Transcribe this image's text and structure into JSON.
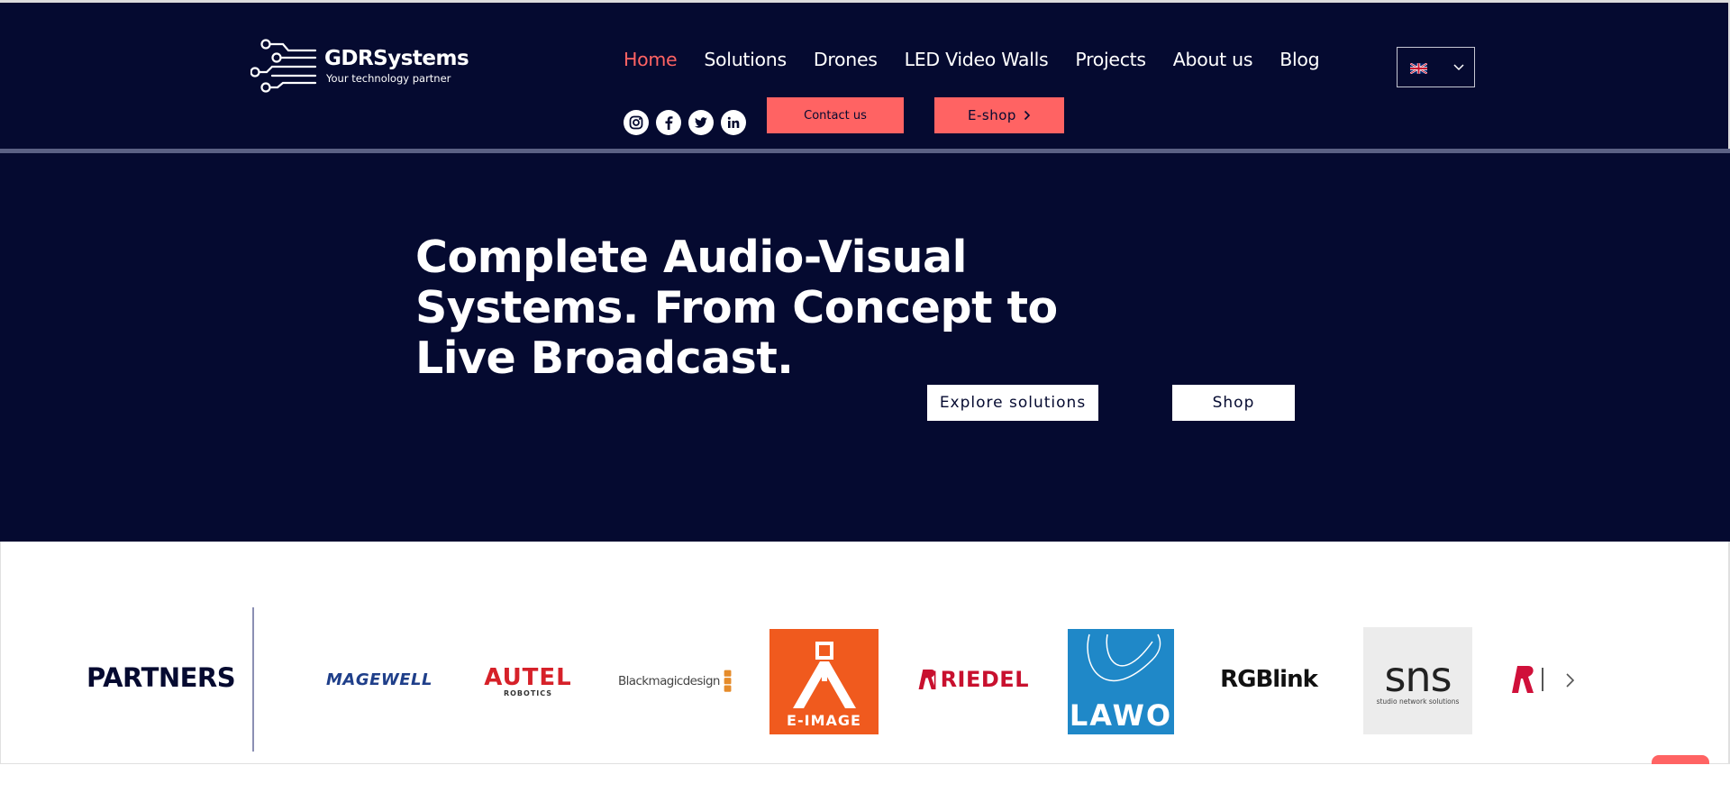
{
  "site": {
    "brand": "GDRSystems",
    "tagline": "Your technology partner"
  },
  "nav": {
    "items": [
      {
        "label": "Home",
        "active": true
      },
      {
        "label": "Solutions",
        "active": false
      },
      {
        "label": "Drones",
        "active": false
      },
      {
        "label": "LED Video Walls",
        "active": false
      },
      {
        "label": "Projects",
        "active": false
      },
      {
        "label": "About us",
        "active": false
      },
      {
        "label": "Blog",
        "active": false
      }
    ]
  },
  "language": {
    "icon": "uk-flag-icon"
  },
  "social": [
    "instagram-icon",
    "facebook-icon",
    "twitter-icon",
    "linkedin-icon"
  ],
  "header_buttons": {
    "contact": "Contact us",
    "eshop": "E-shop"
  },
  "hero": {
    "title": "Complete Audio-Visual Systems. From Concept to Live Broadcast.",
    "explore": "Explore solutions",
    "shop": "Shop"
  },
  "partners": {
    "title": "PARTNERS",
    "logos": [
      "MAGEWELL",
      "AUTEL",
      "ROBOTICS",
      "Blackmagicdesign",
      "E-IMAGE",
      "RIEDEL",
      "LAWO",
      "RGBlink",
      "sns",
      "studio network solutions"
    ]
  },
  "colors": {
    "navy": "#050a30",
    "coral": "#ff6363",
    "white": "#ffffff"
  }
}
